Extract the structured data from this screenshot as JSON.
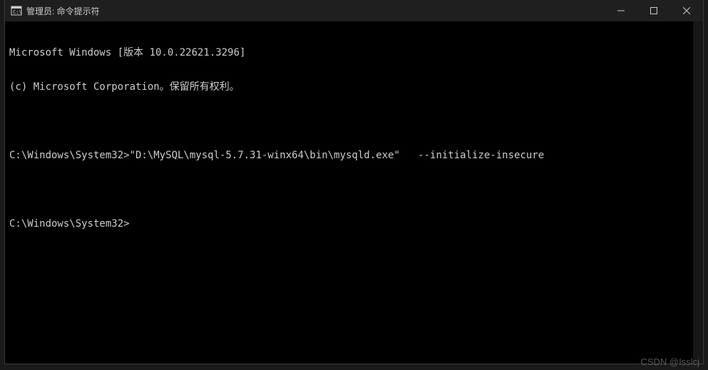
{
  "titlebar": {
    "title": "管理员: 命令提示符"
  },
  "terminal": {
    "lines": [
      "Microsoft Windows [版本 10.0.22621.3296]",
      "(c) Microsoft Corporation。保留所有权利。",
      "",
      "C:\\Windows\\System32>\"D:\\MySQL\\mysql-5.7.31-winx64\\bin\\mysqld.exe\"   --initialize-insecure",
      "",
      "C:\\Windows\\System32>"
    ]
  },
  "watermark": "CSDN @Isslcj"
}
